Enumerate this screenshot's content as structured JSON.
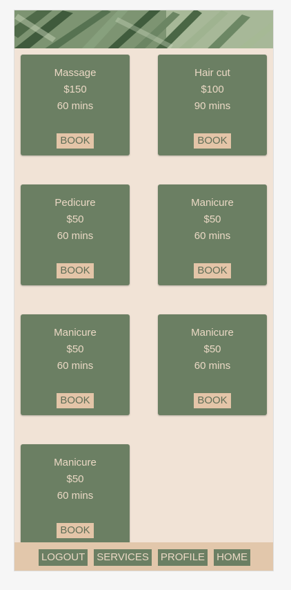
{
  "colors": {
    "background": "#f1e3d6",
    "card": "#6b7f63",
    "card_text": "#ead8c4",
    "book_button": "#e4c5a8",
    "navbar": "#e2c7ab"
  },
  "services": [
    {
      "name": "Massage",
      "price": "$150",
      "duration": "60 mins",
      "book_label": "BOOK"
    },
    {
      "name": "Hair cut",
      "price": "$100",
      "duration": "90 mins",
      "book_label": "BOOK"
    },
    {
      "name": "Pedicure",
      "price": "$50",
      "duration": "60 mins",
      "book_label": "BOOK"
    },
    {
      "name": "Manicure",
      "price": "$50",
      "duration": "60 mins",
      "book_label": "BOOK"
    },
    {
      "name": "Manicure",
      "price": "$50",
      "duration": "60 mins",
      "book_label": "BOOK"
    },
    {
      "name": "Manicure",
      "price": "$50",
      "duration": "60 mins",
      "book_label": "BOOK"
    },
    {
      "name": "Manicure",
      "price": "$50",
      "duration": "60 mins",
      "book_label": "BOOK"
    }
  ],
  "navbar": {
    "items": [
      {
        "label": "LOGOUT"
      },
      {
        "label": "SERVICES"
      },
      {
        "label": "PROFILE"
      },
      {
        "label": "HOME"
      }
    ]
  }
}
